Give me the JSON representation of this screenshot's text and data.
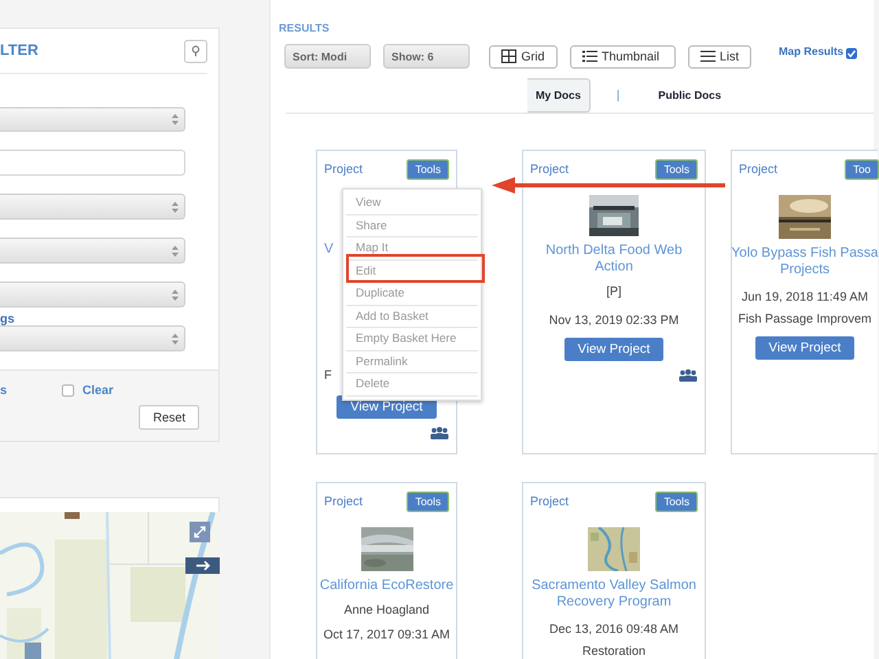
{
  "filter_panel": {
    "title": "LTER",
    "fields": [
      {
        "kind": "select"
      },
      {
        "kind": "text"
      },
      {
        "kind": "select"
      },
      {
        "kind": "select"
      },
      {
        "kind": "select"
      },
      {
        "kind": "select",
        "label": "gs"
      }
    ],
    "footer": {
      "link": "s",
      "clear": {
        "label": "Clear",
        "checked": false
      },
      "reset": "Reset"
    }
  },
  "results": {
    "heading": "RESULTS",
    "sort": "Sort: Modi",
    "show": "Show: 6",
    "views": [
      {
        "label": "Grid"
      },
      {
        "label": "Thumbnail"
      },
      {
        "label": "List"
      }
    ],
    "map_results": {
      "label": "Map Results",
      "checked": true
    },
    "tabs": [
      {
        "label": "My Docs",
        "selected": true
      },
      {
        "label": "Public Docs",
        "selected": false
      }
    ],
    "separator": "|",
    "cards": [
      {
        "type": "Project",
        "tools": "Tools",
        "title_lines": [
          "V"
        ],
        "category": "F",
        "button": "View Project",
        "shared": true
      },
      {
        "type": "Project",
        "tools": "Tools",
        "title_lines": [
          "North Delta Food Web",
          "Action"
        ],
        "byline": "[P]",
        "date": "Nov 13, 2019 02:33 PM",
        "button": "View Project",
        "shared": true
      },
      {
        "type": "Project",
        "tools": "Too",
        "title_lines": [
          "Yolo Bypass Fish Passa",
          "Projects"
        ],
        "date": "Jun 19, 2018 11:49 AM",
        "category": "Fish Passage Improvem",
        "button": "View Project",
        "shared": false
      },
      {
        "type": "Project",
        "tools": "Tools",
        "title_lines": [
          "California EcoRestore"
        ],
        "byline": "Anne Hoagland",
        "date": "Oct 17, 2017 09:31 AM",
        "shared": false
      },
      {
        "type": "Project",
        "tools": "Tools",
        "title_lines": [
          "Sacramento Valley Salmon",
          "Recovery Program"
        ],
        "date": "Dec 13, 2016 09:48 AM",
        "category": "Restoration",
        "shared": false
      }
    ]
  },
  "tools_menu": {
    "items": [
      "View",
      "Share",
      "Map It",
      "Edit",
      "Duplicate",
      "Add to Basket",
      "Empty Basket Here",
      "Permalink",
      "Delete"
    ]
  }
}
